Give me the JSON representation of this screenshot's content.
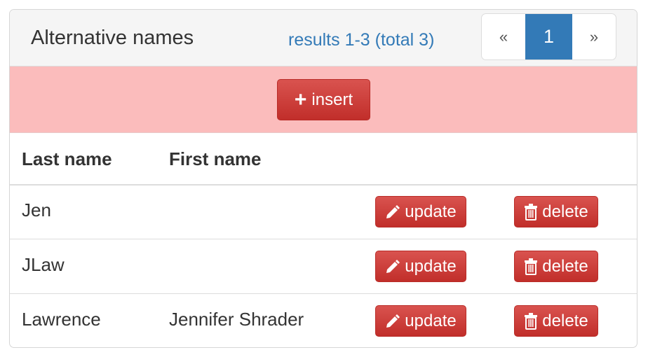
{
  "panel": {
    "title": "Alternative names",
    "results_text": "results 1-3 (total 3)"
  },
  "pagination": {
    "prev": "«",
    "current": "1",
    "next": "»",
    "active_color": "#337ab7"
  },
  "toolbar": {
    "insert_icon": "+",
    "insert_label": "insert",
    "insert_row_color": "#fbbcbc"
  },
  "table": {
    "columns": [
      "Last name",
      "First name"
    ],
    "rows": [
      {
        "last_name": "Jen",
        "first_name": "",
        "update_label": "update",
        "delete_label": "delete"
      },
      {
        "last_name": "JLaw",
        "first_name": "",
        "update_label": "update",
        "delete_label": "delete"
      },
      {
        "last_name": "Lawrence",
        "first_name": "Jennifer Shrader",
        "update_label": "update",
        "delete_label": "delete"
      }
    ]
  },
  "icons": {
    "insert": "plus-icon",
    "update": "pencil-icon",
    "delete": "trash-icon"
  },
  "colors": {
    "button_red": "#d9534f",
    "link_blue": "#337ab7"
  }
}
